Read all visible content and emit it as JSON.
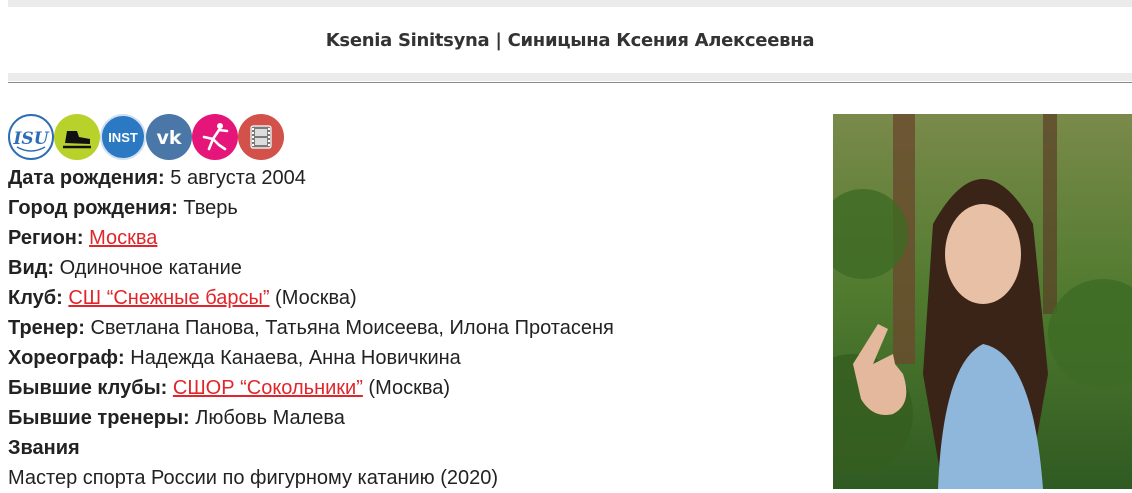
{
  "title": "Ksenia Sinitsyna | Синицына Ксения Алексеевна",
  "icons": [
    {
      "name": "isu-icon",
      "text": "ISU"
    },
    {
      "name": "skate-icon"
    },
    {
      "name": "instagram-icon",
      "text": "INST"
    },
    {
      "name": "vk-icon",
      "text": "vk"
    },
    {
      "name": "skater-icon"
    },
    {
      "name": "film-icon"
    }
  ],
  "fields": {
    "birth_date": {
      "label": "Дата рождения:",
      "value": "5 августа 2004"
    },
    "birth_city": {
      "label": "Город рождения:",
      "value": "Тверь"
    },
    "region": {
      "label": "Регион:",
      "link": "Москва"
    },
    "discipline": {
      "label": "Вид:",
      "value": "Одиночное катание"
    },
    "club": {
      "label": "Клуб:",
      "link": "СШ “Снежные барсы”",
      "suffix": " (Москва)"
    },
    "coach": {
      "label": "Тренер:",
      "value": "Светлана Панова, Татьяна Моисеева, Илона Протасеня"
    },
    "choreographer": {
      "label": "Хореограф:",
      "value": "Надежда Канаева, Анна Новичкина"
    },
    "former_clubs": {
      "label": "Бывшие клубы:",
      "link": "СШОР “Сокольники”",
      "suffix": " (Москва)"
    },
    "former_coaches": {
      "label": "Бывшие тренеры:",
      "value": "Любовь Малева"
    },
    "titles_heading": "Звания",
    "titles_value": "Мастер спорта России по фигурному катанию (2020)"
  },
  "colors": {
    "link": "#e0262b",
    "band": "#ebebeb"
  }
}
